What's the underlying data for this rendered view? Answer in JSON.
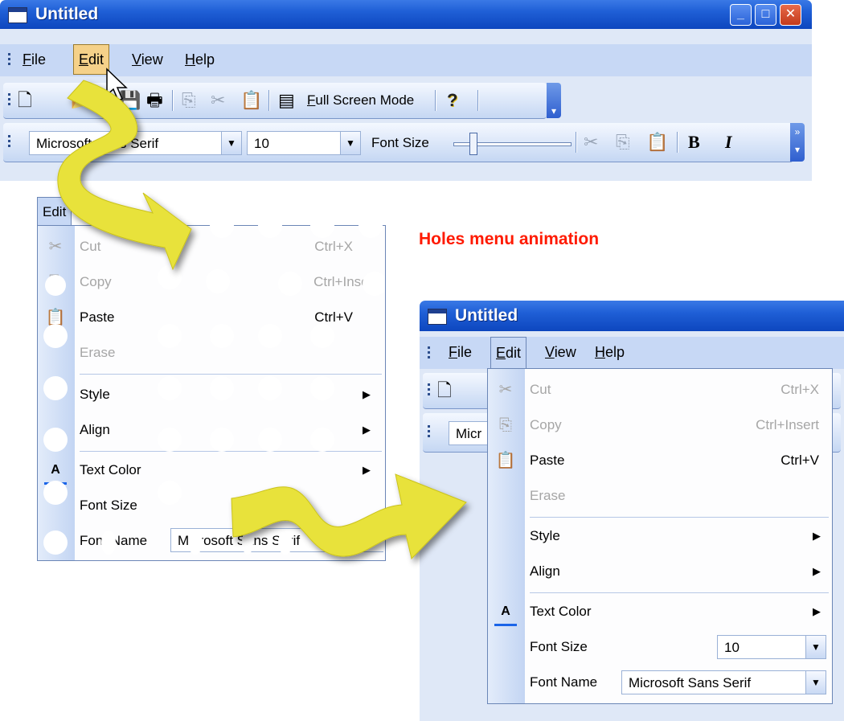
{
  "window_title": "Untitled",
  "caption_buttons": [
    "_",
    "□",
    "✕"
  ],
  "menubar": [
    "File",
    "Edit",
    "View",
    "Help"
  ],
  "toolbar": {
    "full_screen_label": "Full Screen Mode"
  },
  "format_bar": {
    "font_name": "Microsoft Sans Serif",
    "font_size": "10",
    "font_size_label": "Font Size",
    "bold": "B",
    "italic": "I"
  },
  "edit_tab": "Edit",
  "caption": "Holes menu animation",
  "menu": {
    "cut": {
      "label": "Cut",
      "shortcut": "Ctrl+X"
    },
    "copy": {
      "label": "Copy",
      "shortcut": "Ctrl+Insert"
    },
    "paste": {
      "label": "Paste",
      "shortcut": "Ctrl+V"
    },
    "erase": {
      "label": "Erase"
    },
    "style": {
      "label": "Style"
    },
    "align": {
      "label": "Align"
    },
    "text_color": {
      "label": "Text Color"
    },
    "font_size": {
      "label": "Font Size",
      "value": "10"
    },
    "font_name": {
      "label": "Font Name",
      "value": "Microsoft Sans Serif"
    }
  },
  "colors": {
    "title_blue": "#1f5fd6",
    "menu_highlight": "#f5d189",
    "caption_red": "#ff1a00",
    "arrow_yellow": "#e8e23a"
  }
}
